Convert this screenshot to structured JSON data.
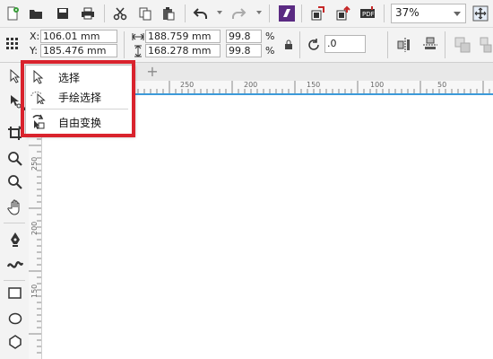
{
  "toolbar": {
    "zoom_value": "37%",
    "icons": [
      "new-document-icon",
      "open-folder-icon",
      "save-icon",
      "print-icon",
      "cut-icon",
      "copy-icon",
      "paste-icon",
      "undo-icon",
      "redo-icon",
      "app-launcher-icon",
      "import-icon",
      "export-icon",
      "export-pdf-icon",
      "zoom-dropdown",
      "full-screen-icon"
    ]
  },
  "property_bar": {
    "x_label": "X:",
    "x_value": "106.01 mm",
    "y_label": "Y:",
    "y_value": "185.476 mm",
    "width_value": "188.759 mm",
    "height_value": "168.278 mm",
    "scale_x": "99.8",
    "scale_y": "99.8",
    "percent_x": "%",
    "percent_y": "%",
    "rotation_value": ".0"
  },
  "rulers": {
    "horizontal": [
      "250",
      "200",
      "150",
      "100",
      "50"
    ],
    "vertical": [
      "250",
      "200",
      "150"
    ]
  },
  "tab_add_label": "+",
  "flyout": {
    "items": [
      {
        "label": "选择",
        "icon": "pick-arrow-icon"
      },
      {
        "label": "手绘选择",
        "icon": "freehand-pick-icon"
      },
      {
        "label": "自由变换",
        "icon": "free-transform-icon"
      }
    ]
  },
  "colors": {
    "highlight": "#d9232d",
    "ruler_line": "#3c9ad9"
  }
}
